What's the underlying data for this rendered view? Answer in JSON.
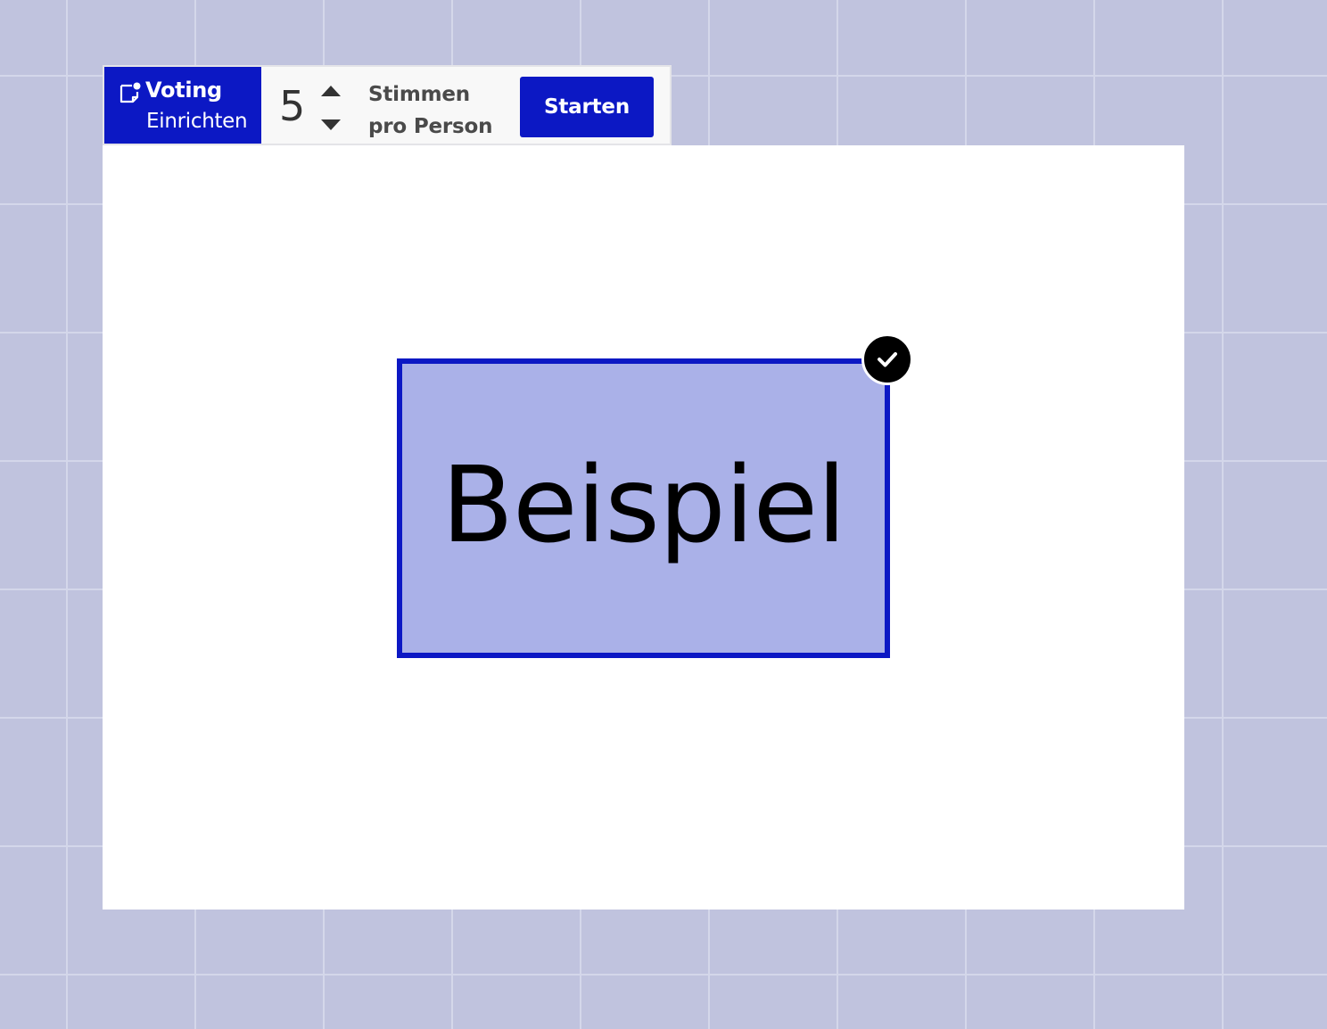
{
  "toolbar": {
    "voting_title": "Voting",
    "voting_subtitle": "Einrichten",
    "votes_count": "5",
    "votes_label_line1": "Stimmen",
    "votes_label_line2": "pro Person",
    "start_label": "Starten",
    "icons": {
      "voting": "sticky-note-dot-icon",
      "increment": "triangle-up-icon",
      "decrement": "triangle-down-icon"
    }
  },
  "canvas": {
    "card_text": "Beispiel",
    "card_selected": true,
    "badge_icon": "checkmark-icon"
  },
  "colors": {
    "accent": "#0c18c4",
    "card_fill": "#aab1e8",
    "background": "#c0c3de",
    "canvas": "#ffffff"
  }
}
